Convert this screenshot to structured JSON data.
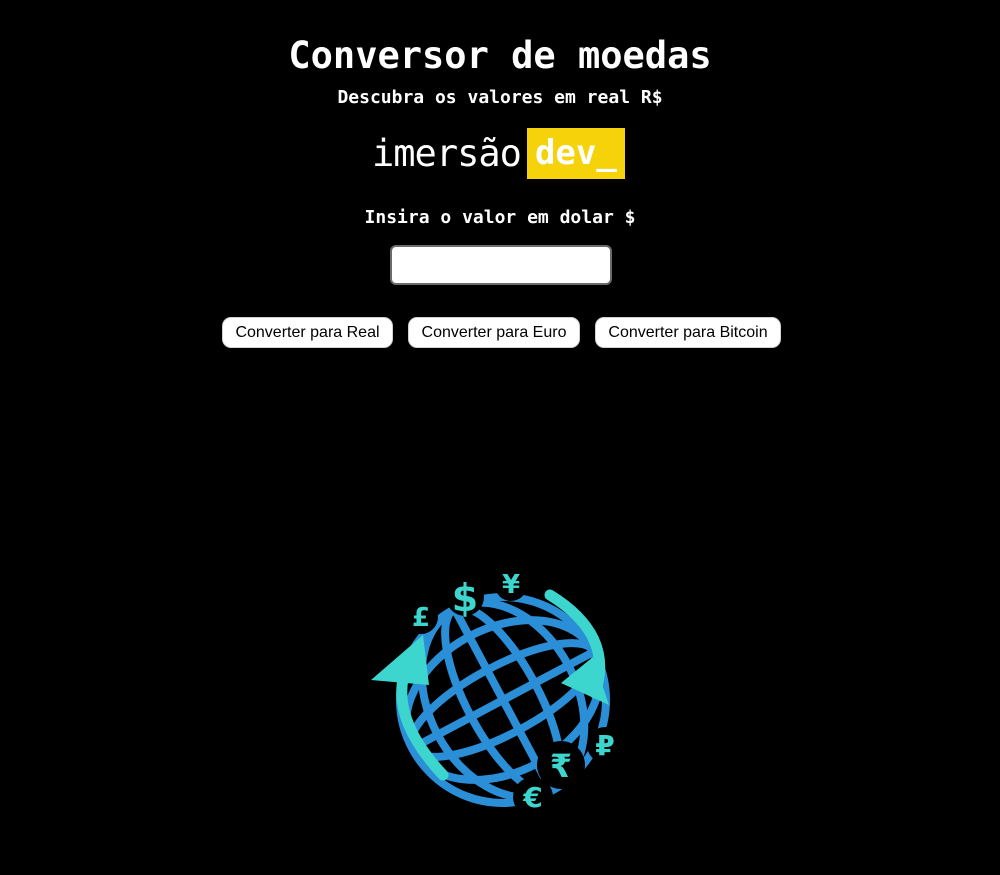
{
  "header": {
    "title": "Conversor de moedas",
    "subtitle": "Descubra os valores em real R$"
  },
  "logo": {
    "part1": "imersão",
    "part2": "dev_",
    "highlight_color": "#f5d20a"
  },
  "form": {
    "label": "Insira o valor em dolar $",
    "input_value": "",
    "input_placeholder": ""
  },
  "buttons": {
    "real": "Converter para Real",
    "euro": "Converter para Euro",
    "bitcoin": "Converter para Bitcoin"
  },
  "illustration": {
    "icon": "currency-globe-icon",
    "symbols": [
      "£",
      "$",
      "¥",
      "€",
      "₹",
      "₽"
    ],
    "globe_color": "#2b8fd8",
    "accent_color": "#3dd6cf"
  }
}
